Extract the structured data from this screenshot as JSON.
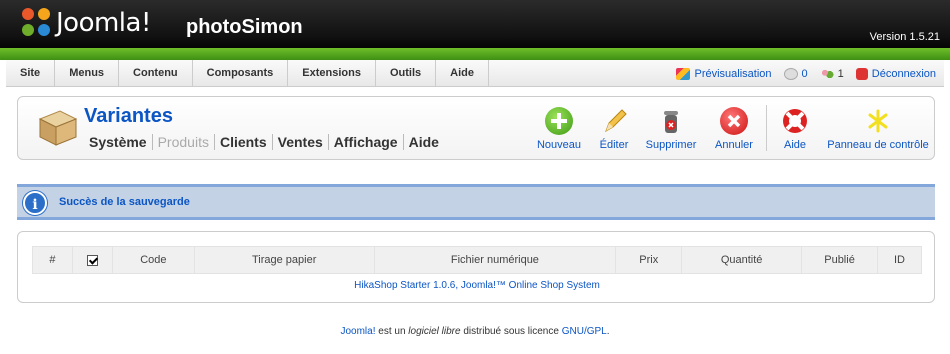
{
  "header": {
    "logo_text": "Joomla!",
    "site_name": "photoSimon",
    "version": "Version 1.5.21"
  },
  "menu": [
    {
      "label": "Site"
    },
    {
      "label": "Menus"
    },
    {
      "label": "Contenu"
    },
    {
      "label": "Composants"
    },
    {
      "label": "Extensions"
    },
    {
      "label": "Outils"
    },
    {
      "label": "Aide"
    }
  ],
  "status": {
    "preview": "Prévisualisation",
    "messages": "0",
    "users": "1",
    "logout": "Déconnexion"
  },
  "page": {
    "title": "Variantes",
    "submenu": [
      "Système",
      "Produits",
      "Clients",
      "Ventes",
      "Affichage",
      "Aide"
    ]
  },
  "toolbar": {
    "new": "Nouveau",
    "edit": "Éditer",
    "delete": "Supprimer",
    "cancel": "Annuler",
    "help": "Aide",
    "control_panel": "Panneau de contrôle"
  },
  "message": {
    "text": "Succès de la sauvegarde"
  },
  "table": {
    "columns": [
      "#",
      "",
      "Code",
      "Tirage papier",
      "Fichier numérique",
      "Prix",
      "Quantité",
      "Publié",
      "ID"
    ],
    "footer": "HikaShop Starter 1.0.6, Joomla!™ Online Shop System"
  },
  "footer": {
    "joomla": "Joomla!",
    "text1": " est un ",
    "free": "logiciel libre",
    "text2": " distribué sous licence ",
    "license": "GNU/GPL",
    "end": "."
  },
  "colors": {
    "accent": "#0b55c4",
    "green": "#4c9e1c",
    "message_bg": "#c3d2e5"
  }
}
